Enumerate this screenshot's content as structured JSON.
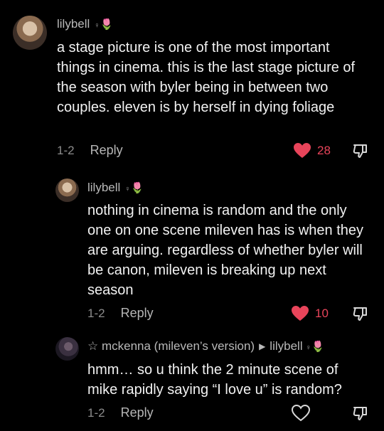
{
  "comments": [
    {
      "username": "lilybell",
      "text": "a stage picture is one of the most important things in cinema. this is the last stage picture of the season with byler being in between two couples. eleven is by herself in dying foliage",
      "date": "1-2",
      "reply_label": "Reply",
      "likes": "28",
      "liked": true
    },
    {
      "username": "lilybell",
      "text": "nothing in cinema is random and the only one on one scene mileven has is when they are arguing. regardless of whether byler will be canon, mileven is breaking up next season",
      "date": "1-2",
      "reply_label": "Reply",
      "likes": "10",
      "liked": true
    },
    {
      "username": "☆ mckenna (mileven’s version)",
      "reply_to": "lilybell",
      "text": "hmm… so u think the 2 minute scene of mike rapidly saying “I love u” is random?",
      "date": "1-2",
      "reply_label": "Reply",
      "likes": "",
      "liked": false
    }
  ],
  "colors": {
    "background": "#000000",
    "like_active": "#e8445a",
    "text": "#f2f2f2",
    "muted": "#8c8c8c"
  },
  "icons": {
    "like": "heart-icon",
    "dislike": "thumbs-down-icon",
    "decoration": "tulip-emoji",
    "reply_arrow": "triangle-right-icon"
  }
}
